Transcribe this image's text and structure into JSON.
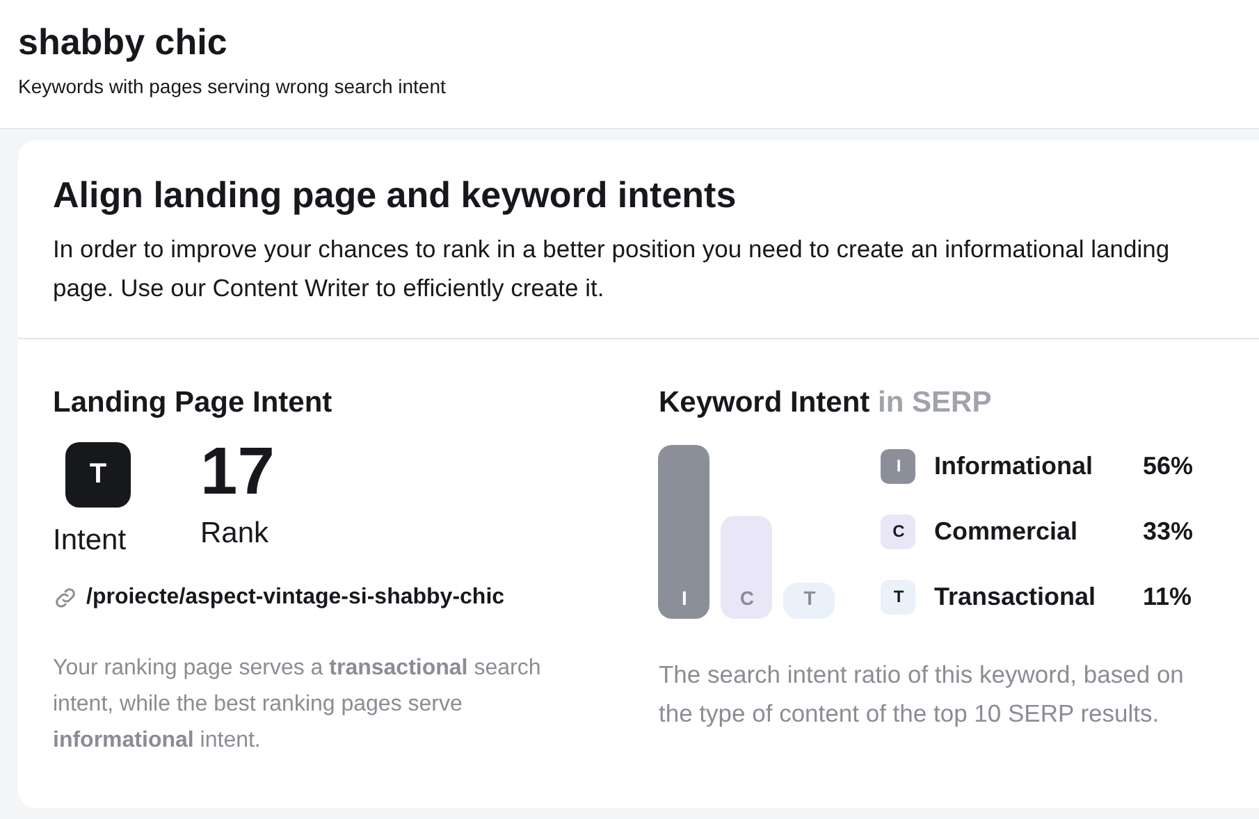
{
  "header": {
    "title": "shabby chic",
    "subtitle": "Keywords with pages serving wrong search intent"
  },
  "card": {
    "title": "Align landing page and keyword intents",
    "description": "In order to improve your chances to rank in a better position you need to create an informational landing page. Use our Content Writer to efficiently create it."
  },
  "landing_page": {
    "title": "Landing Page Intent",
    "intent_badge": "T",
    "intent_label": "Intent",
    "rank": "17",
    "rank_label": "Rank",
    "url": "/proiecte/aspect-vintage-si-shabby-chic",
    "note": "Your ranking page serves a **transactional** search intent, while the best ranking pages serve **informational** intent."
  },
  "keyword_intent": {
    "title": "Keyword Intent",
    "title_suffix": "in SERP",
    "intents": [
      {
        "bar_letter": "I",
        "letter": "I",
        "name": "Informational",
        "percent": "56%",
        "color": "#8b8f9a"
      },
      {
        "bar_letter": "C",
        "letter": "C",
        "name": "Commercial",
        "percent": "33%",
        "color": "#e9e6f7"
      },
      {
        "bar_letter": "T",
        "letter": "T",
        "name": "Transactional",
        "percent": "11%",
        "color": "#eaf1fb"
      }
    ],
    "note": "The search intent ratio of this keyword, based on the type of content of the top 10 SERP results."
  }
}
